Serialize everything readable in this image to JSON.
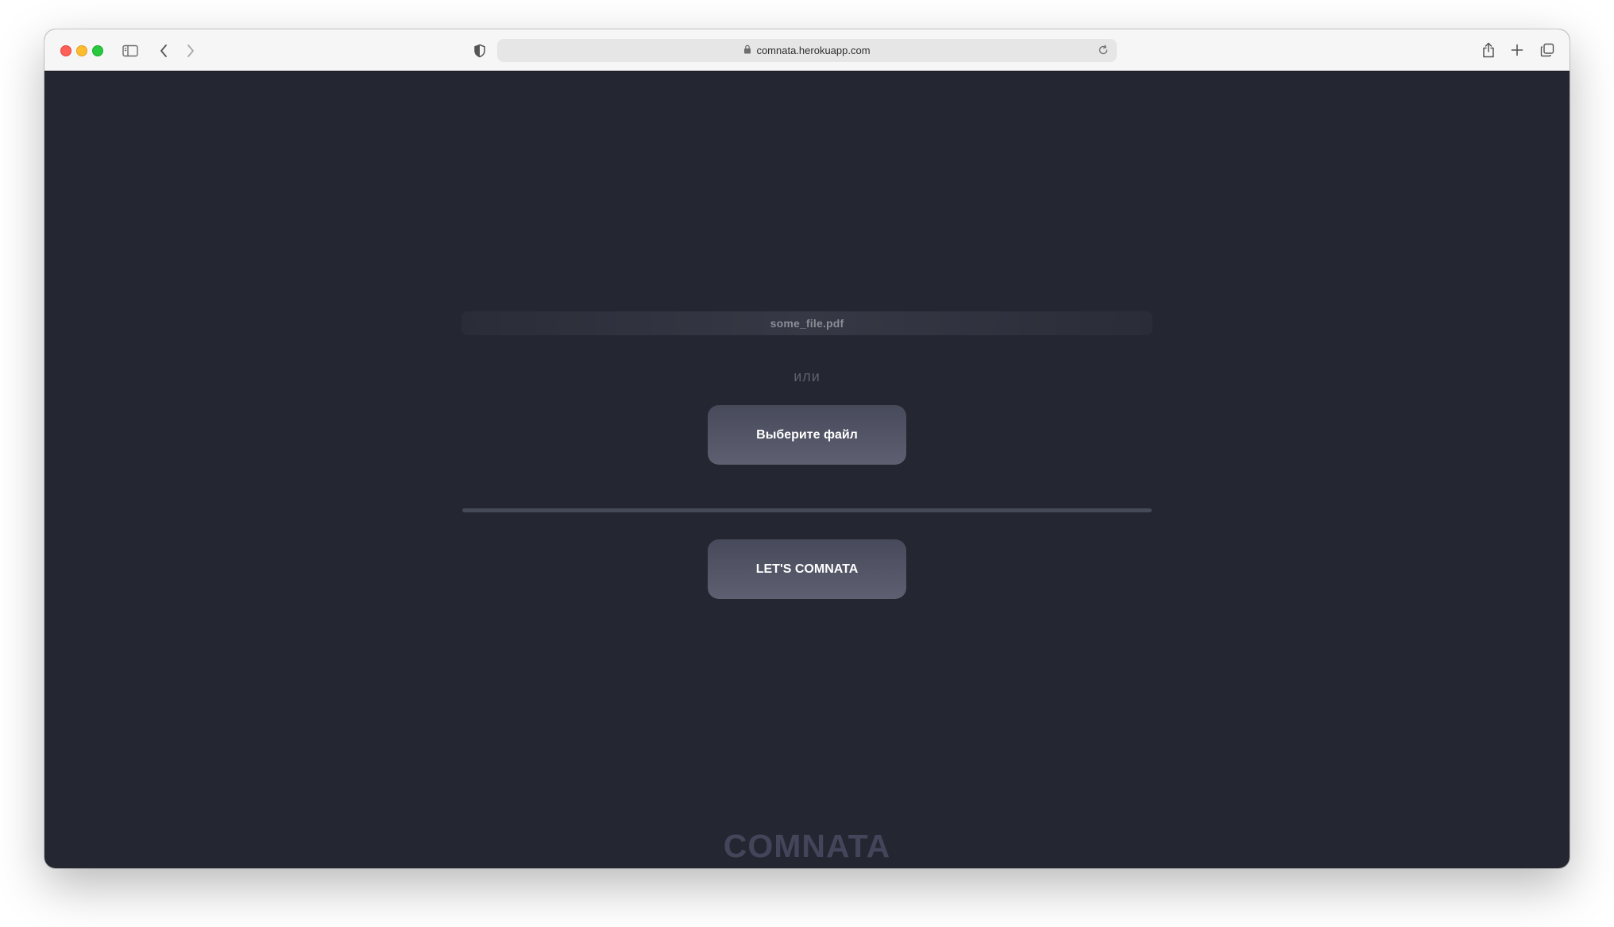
{
  "browser": {
    "url": "comnata.herokuapp.com",
    "icons": {
      "sidebar": "sidebar-icon",
      "back": "chevron-left-icon",
      "forward": "chevron-right-icon",
      "shield": "shield-icon",
      "lock": "lock-icon",
      "reload": "reload-icon",
      "share": "share-icon",
      "new_tab": "plus-icon",
      "tabs": "tabs-overview-icon"
    }
  },
  "page": {
    "file_name": "some_file.pdf",
    "or_label": "или",
    "choose_file_label": "Выберите файл",
    "submit_label": "LET'S COMNATA",
    "logo_text": "COMNATA"
  },
  "colors": {
    "background": "#242731",
    "button_top": "#474a5a",
    "button_bottom": "#5e6071",
    "logo": "#43465a"
  }
}
